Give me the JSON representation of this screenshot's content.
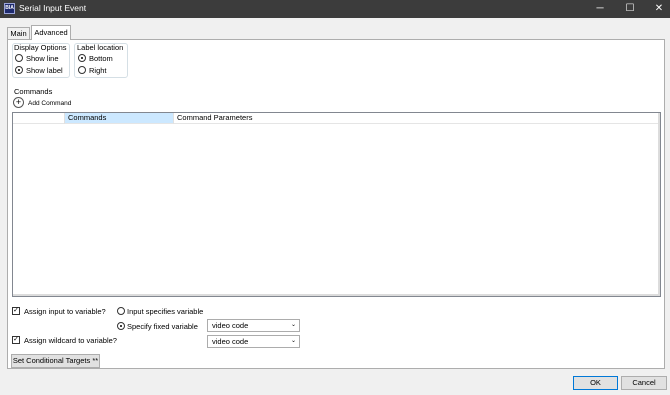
{
  "window": {
    "title": "Serial Input Event",
    "icon_text": "BIA",
    "minimize": "─",
    "maximize": "☐",
    "close": "✕"
  },
  "tabs": [
    {
      "label": "Main"
    },
    {
      "label": "Advanced"
    }
  ],
  "display_options": {
    "title": "Display Options",
    "options": [
      {
        "label": "Show line",
        "selected": false
      },
      {
        "label": "Show label",
        "selected": true
      }
    ]
  },
  "label_location": {
    "title": "Label location",
    "options": [
      {
        "label": "Bottom",
        "selected": true
      },
      {
        "label": "Right",
        "selected": false
      }
    ]
  },
  "commands": {
    "title": "Commands",
    "add_icon": "+",
    "add_label": "Add Command",
    "columns": [
      "Commands",
      "Command Parameters"
    ],
    "rows": []
  },
  "assign": {
    "assign_input_label": "Assign input to variable?",
    "assign_input_checked": true,
    "checkmark": "✓",
    "input_specifies_label": "Input specifies variable",
    "specify_fixed_label": "Specify fixed variable",
    "fixed_variable_value": "video code",
    "assign_wildcard_label": "Assign wildcard to variable?",
    "assign_wildcard_checked": true,
    "wildcard_variable_value": "video code",
    "dropdown_arrow": "⌄"
  },
  "set_targets_label": "Set Conditional Targets **",
  "footer": {
    "ok_label": "OK",
    "cancel_label": "Cancel"
  },
  "colors": {
    "titlebar": "#3c3c3c",
    "selected_column": "#cce8ff",
    "accent": "#0078d7"
  }
}
